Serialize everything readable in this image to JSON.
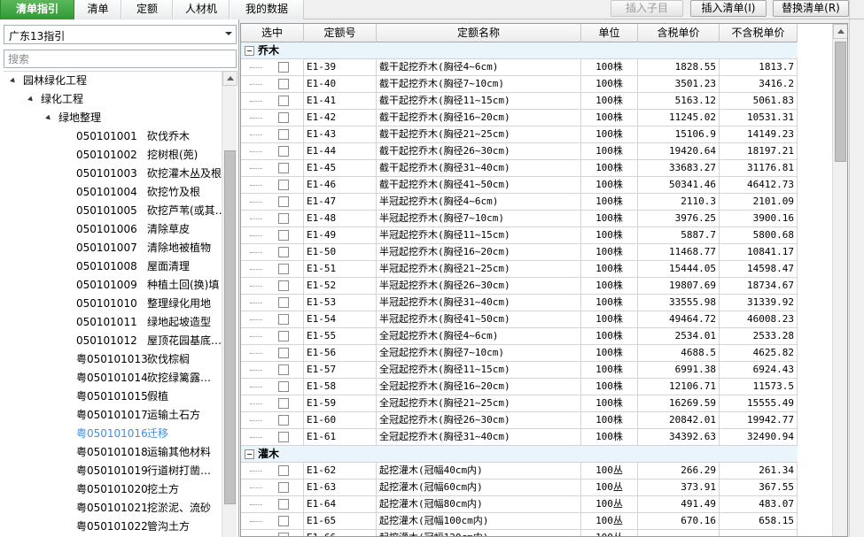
{
  "tabs": [
    {
      "label": "清单指引",
      "active": true
    },
    {
      "label": "清单",
      "active": false
    },
    {
      "label": "定额",
      "active": false
    },
    {
      "label": "人材机",
      "active": false
    },
    {
      "label": "我的数据",
      "active": false
    }
  ],
  "toolbar": {
    "insert_child": "插入子目",
    "insert_list": "插入清单(I)",
    "replace_list": "替换清单(R)"
  },
  "left": {
    "combo_value": "广东13指引",
    "search_placeholder": "搜索",
    "tree": [
      {
        "level": 0,
        "code": "",
        "name": "园林绿化工程",
        "expanded": true
      },
      {
        "level": 1,
        "code": "",
        "name": "绿化工程",
        "expanded": true
      },
      {
        "level": 2,
        "code": "",
        "name": "绿地整理",
        "expanded": true
      },
      {
        "level": 3,
        "code": "050101001",
        "name": "砍伐乔木"
      },
      {
        "level": 3,
        "code": "050101002",
        "name": "挖树根(蔸)"
      },
      {
        "level": 3,
        "code": "050101003",
        "name": "砍挖灌木丛及根"
      },
      {
        "level": 3,
        "code": "050101004",
        "name": "砍挖竹及根"
      },
      {
        "level": 3,
        "code": "050101005",
        "name": "砍挖芦苇(或其…"
      },
      {
        "level": 3,
        "code": "050101006",
        "name": "清除草皮"
      },
      {
        "level": 3,
        "code": "050101007",
        "name": "清除地被植物"
      },
      {
        "level": 3,
        "code": "050101008",
        "name": "屋面清理"
      },
      {
        "level": 3,
        "code": "050101009",
        "name": "种植土回(换)填"
      },
      {
        "level": 3,
        "code": "050101010",
        "name": "整理绿化用地"
      },
      {
        "level": 3,
        "code": "050101011",
        "name": "绿地起坡造型"
      },
      {
        "level": 3,
        "code": "050101012",
        "name": "屋顶花园基底…"
      },
      {
        "level": 3,
        "code": "粤050101013",
        "name": "砍伐棕榈"
      },
      {
        "level": 3,
        "code": "粤050101014",
        "name": "砍挖绿篱露…"
      },
      {
        "level": 3,
        "code": "粤050101015",
        "name": "假植"
      },
      {
        "level": 3,
        "code": "粤050101017",
        "name": "运输土石方"
      },
      {
        "level": 3,
        "code": "粤050101016",
        "name": "迁移",
        "selected": true
      },
      {
        "level": 3,
        "code": "粤050101018",
        "name": "运输其他材料"
      },
      {
        "level": 3,
        "code": "粤050101019",
        "name": "行道树打凿…"
      },
      {
        "level": 3,
        "code": "粤050101020",
        "name": "挖土方"
      },
      {
        "level": 3,
        "code": "粤050101021",
        "name": "挖淤泥、流砂"
      },
      {
        "level": 3,
        "code": "粤050101022",
        "name": "管沟土方"
      }
    ]
  },
  "grid": {
    "headers": [
      "选中",
      "定额号",
      "定额名称",
      "单位",
      "含税单价",
      "不含税单价"
    ],
    "groups": [
      {
        "title": "乔木",
        "rows": [
          [
            "E1-39",
            "截干起挖乔木(胸径4~6cm)",
            "100株",
            "1828.55",
            "1813.7"
          ],
          [
            "E1-40",
            "截干起挖乔木(胸径7~10cm)",
            "100株",
            "3501.23",
            "3416.2"
          ],
          [
            "E1-41",
            "截干起挖乔木(胸径11~15cm)",
            "100株",
            "5163.12",
            "5061.83"
          ],
          [
            "E1-42",
            "截干起挖乔木(胸径16~20cm)",
            "100株",
            "11245.02",
            "10531.31"
          ],
          [
            "E1-43",
            "截干起挖乔木(胸径21~25cm)",
            "100株",
            "15106.9",
            "14149.23"
          ],
          [
            "E1-44",
            "截干起挖乔木(胸径26~30cm)",
            "100株",
            "19420.64",
            "18197.21"
          ],
          [
            "E1-45",
            "截干起挖乔木(胸径31~40cm)",
            "100株",
            "33683.27",
            "31176.81"
          ],
          [
            "E1-46",
            "截干起挖乔木(胸径41~50cm)",
            "100株",
            "50341.46",
            "46412.73"
          ],
          [
            "E1-47",
            "半冠起挖乔木(胸径4~6cm)",
            "100株",
            "2110.3",
            "2101.09"
          ],
          [
            "E1-48",
            "半冠起挖乔木(胸径7~10cm)",
            "100株",
            "3976.25",
            "3900.16"
          ],
          [
            "E1-49",
            "半冠起挖乔木(胸径11~15cm)",
            "100株",
            "5887.7",
            "5800.68"
          ],
          [
            "E1-50",
            "半冠起挖乔木(胸径16~20cm)",
            "100株",
            "11468.77",
            "10841.17"
          ],
          [
            "E1-51",
            "半冠起挖乔木(胸径21~25cm)",
            "100株",
            "15444.05",
            "14598.47"
          ],
          [
            "E1-52",
            "半冠起挖乔木(胸径26~30cm)",
            "100株",
            "19807.69",
            "18734.67"
          ],
          [
            "E1-53",
            "半冠起挖乔木(胸径31~40cm)",
            "100株",
            "33555.98",
            "31339.92"
          ],
          [
            "E1-54",
            "半冠起挖乔木(胸径41~50cm)",
            "100株",
            "49464.72",
            "46008.23"
          ],
          [
            "E1-55",
            "全冠起挖乔木(胸径4~6cm)",
            "100株",
            "2534.01",
            "2533.28"
          ],
          [
            "E1-56",
            "全冠起挖乔木(胸径7~10cm)",
            "100株",
            "4688.5",
            "4625.82"
          ],
          [
            "E1-57",
            "全冠起挖乔木(胸径11~15cm)",
            "100株",
            "6991.38",
            "6924.43"
          ],
          [
            "E1-58",
            "全冠起挖乔木(胸径16~20cm)",
            "100株",
            "12106.71",
            "11573.5"
          ],
          [
            "E1-59",
            "全冠起挖乔木(胸径21~25cm)",
            "100株",
            "16269.59",
            "15555.49"
          ],
          [
            "E1-60",
            "全冠起挖乔木(胸径26~30cm)",
            "100株",
            "20842.01",
            "19942.77"
          ],
          [
            "E1-61",
            "全冠起挖乔木(胸径31~40cm)",
            "100株",
            "34392.63",
            "32490.94"
          ]
        ]
      },
      {
        "title": "灌木",
        "rows": [
          [
            "E1-62",
            "起挖灌木(冠幅40cm内)",
            "100丛",
            "266.29",
            "261.34"
          ],
          [
            "E1-63",
            "起挖灌木(冠幅60cm内)",
            "100丛",
            "373.91",
            "367.55"
          ],
          [
            "E1-64",
            "起挖灌木(冠幅80cm内)",
            "100丛",
            "491.49",
            "483.07"
          ],
          [
            "E1-65",
            "起挖灌木(冠幅100cm内)",
            "100丛",
            "670.16",
            "658.15"
          ],
          [
            "E1-66",
            "起挖灌木(冠幅120cm内)",
            "100丛",
            "…",
            "…"
          ]
        ]
      }
    ]
  }
}
